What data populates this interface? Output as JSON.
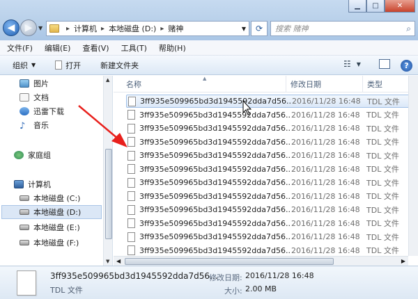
{
  "address": {
    "crumbs": [
      "计算机",
      "本地磁盘 (D:)",
      "赌神"
    ],
    "search_placeholder": "搜索 赌神"
  },
  "menu": [
    "文件(F)",
    "编辑(E)",
    "查看(V)",
    "工具(T)",
    "帮助(H)"
  ],
  "toolbar": {
    "organize": "组织",
    "open": "打开",
    "new_folder": "新建文件夹"
  },
  "nav": {
    "items": [
      {
        "label": "图片",
        "icon": "pictures-icon"
      },
      {
        "label": "文档",
        "icon": "documents-icon"
      },
      {
        "label": "迅雷下载",
        "icon": "download-icon"
      },
      {
        "label": "音乐",
        "icon": "music-icon"
      },
      {
        "label": "家庭组",
        "icon": "homegroup-icon"
      },
      {
        "label": "计算机",
        "icon": "computer-icon"
      },
      {
        "label": "本地磁盘 (C:)",
        "icon": "drive-icon"
      },
      {
        "label": "本地磁盘 (D:)",
        "icon": "drive-icon",
        "selected": true
      },
      {
        "label": "本地磁盘 (E:)",
        "icon": "drive-icon"
      },
      {
        "label": "本地磁盘 (F:)",
        "icon": "drive-icon"
      }
    ]
  },
  "columns": {
    "name": "名称",
    "date": "修改日期",
    "type": "类型"
  },
  "files": [
    {
      "name": "3ff935e509965bd3d1945592dda7d56...",
      "date": "2016/11/28 16:48",
      "type": "TDL 文件",
      "selected": true
    },
    {
      "name": "3ff935e509965bd3d1945592dda7d56...",
      "date": "2016/11/28 16:48",
      "type": "TDL 文件"
    },
    {
      "name": "3ff935e509965bd3d1945592dda7d56...",
      "date": "2016/11/28 16:48",
      "type": "TDL 文件"
    },
    {
      "name": "3ff935e509965bd3d1945592dda7d56...",
      "date": "2016/11/28 16:48",
      "type": "TDL 文件"
    },
    {
      "name": "3ff935e509965bd3d1945592dda7d56...",
      "date": "2016/11/28 16:48",
      "type": "TDL 文件"
    },
    {
      "name": "3ff935e509965bd3d1945592dda7d56...",
      "date": "2016/11/28 16:48",
      "type": "TDL 文件"
    },
    {
      "name": "3ff935e509965bd3d1945592dda7d56...",
      "date": "2016/11/28 16:48",
      "type": "TDL 文件"
    },
    {
      "name": "3ff935e509965bd3d1945592dda7d56...",
      "date": "2016/11/28 16:48",
      "type": "TDL 文件"
    },
    {
      "name": "3ff935e509965bd3d1945592dda7d56...",
      "date": "2016/11/28 16:48",
      "type": "TDL 文件"
    },
    {
      "name": "3ff935e509965bd3d1945592dda7d56...",
      "date": "2016/11/28 16:48",
      "type": "TDL 文件"
    },
    {
      "name": "3ff935e509965bd3d1945592dda7d56...",
      "date": "2016/11/28 16:48",
      "type": "TDL 文件"
    },
    {
      "name": "3ff935e509965bd3d1945592dda7d56...",
      "date": "2016/11/28 16:48",
      "type": "TDL 文件"
    },
    {
      "name": "3ff935e509965bd3d1945592dda7d56...",
      "date": "2016/11/28 16:48",
      "type": "TDL 文件"
    }
  ],
  "details": {
    "name": "3ff935e509965bd3d1945592dda7d56...",
    "type": "TDL 文件",
    "modified_label": "修改日期:",
    "modified_value": "2016/11/28 16:48",
    "size_label": "大小:",
    "size_value": "2.00 MB"
  },
  "colors": {
    "annotation_arrow": "#e8201c",
    "selection": "#dbe8f8"
  }
}
